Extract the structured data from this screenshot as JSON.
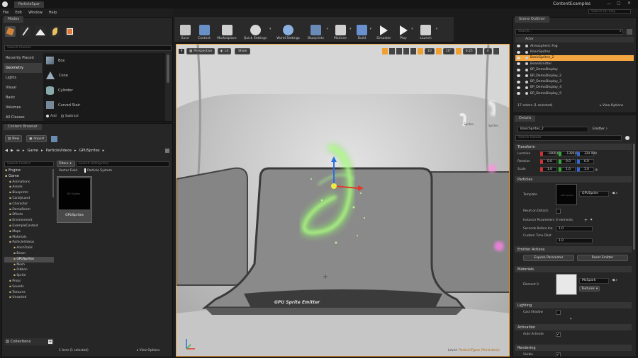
{
  "window": {
    "doc_tab": "ParticleSpar",
    "title": "ContentExamples",
    "search_placeholder": "Search for help"
  },
  "menu": [
    "File",
    "Edit",
    "Window",
    "Help"
  ],
  "modes": {
    "tab": "Modes",
    "search_placeholder": "Search Classes",
    "categories": [
      "Recently Placed",
      "Geometry",
      "Lights",
      "Visual",
      "Basic",
      "Volumes",
      "All Classes"
    ],
    "items": [
      "Box",
      "Cone",
      "Cylinder",
      "Curved Stair"
    ],
    "add": "Add",
    "subtract": "Subtract"
  },
  "content_browser": {
    "tab": "Content Browser",
    "new": "New",
    "import": "Import",
    "path": [
      "Game",
      "ParticleVideos",
      "GPUSprites"
    ],
    "folder_search": "Search Folders",
    "filters": "Filters",
    "asset_search": "Search GPUSprites",
    "filter_tags": [
      "Vector Field",
      "Particle System"
    ],
    "tree": [
      "Engine",
      "Game",
      "Animations",
      "Assets",
      "Blueprints",
      "CandyLand",
      "Character",
      "DemoRoom",
      "Effects",
      "Environment",
      "ExampleContent",
      "Maps",
      "Materials",
      "ParticleVideos",
      "AnimTrails",
      "Beam",
      "GPUSprites",
      "Mesh",
      "Ribbon",
      "Sprite",
      "Props",
      "Sounds",
      "Textures",
      "Unsorted"
    ],
    "asset_name": "GPUSprites",
    "thumb_text": "GPU Sprites",
    "status": "1 item (1 selected)",
    "view_options": "View Options",
    "collections": "Collections"
  },
  "toolbar": [
    "Save",
    "Content",
    "Marketplace",
    "Quick Settings",
    "World Settings",
    "Blueprints",
    "Matinee",
    "Build",
    "Simulate",
    "Play",
    "Launch"
  ],
  "viewport": {
    "perspective": "Perspective",
    "lit": "Lit",
    "show": "Show",
    "grid": "10",
    "angle": "10°",
    "scale": "0.25",
    "cam": "4",
    "sign": "GPU Sprite Emitter",
    "level_label": "Level:",
    "level_name": "ParticleTypes (Persistent)",
    "hud_left": "Sprites",
    "hud_right": "Sprites"
  },
  "outliner": {
    "tab": "Scene Outliner",
    "search_placeholder": "Search...",
    "col": "Actor",
    "items": [
      "Atmospheric Fog",
      "BasicSprites",
      "BasicSprites_2",
      "BeamEmitter",
      "BP_DemoDisplay",
      "BP_DemoDisplay_2",
      "BP_DemoDisplay_3",
      "BP_DemoDisplay_4",
      "BP_DemoDisplay_5"
    ],
    "selected": "BasicSprites_2",
    "status": "17 actors (1 selected)",
    "view_options": "View Options"
  },
  "details": {
    "tab": "Details",
    "name": "BasicSprites_2",
    "emitter": "Emitter",
    "search_placeholder": "Search Details",
    "sections": [
      "Transform",
      "Particles",
      "Emitter Actions",
      "Materials",
      "Lighting",
      "Activation",
      "Rendering"
    ],
    "location": [
      "-1800.0",
      "-1380.0",
      "320.000"
    ],
    "rotation": [
      "0.0",
      "0.0",
      "0.0"
    ],
    "scale": [
      "1.0",
      "1.0",
      "1.0"
    ],
    "labels": {
      "location": "Location",
      "rotation": "Rotation",
      "scale": "Scale",
      "template": "Template",
      "reset_detach": "Reset on Detach",
      "instance_params": "Instance Parameters",
      "seconds_before": "Seconds Before Ina",
      "custom_time": "Custom Time Dilat",
      "element0": "Element 0",
      "cast_shadow": "Cast Shadow",
      "auto_activate": "Auto Activate",
      "visible": "Visible"
    },
    "template_value": "GPUSprite",
    "template_thumb": "GPU Sprites",
    "instance_count": "0 elements",
    "seconds_value": "1.0",
    "custom_value": "1.0",
    "expose": "Expose Parameter",
    "reset_emitter": "Reset Emitter",
    "material": "MxSpark",
    "textures": "Textures"
  },
  "colors": {
    "accent": "#f0a030",
    "selection": "#f4a640",
    "glow": "#7ef05a"
  }
}
